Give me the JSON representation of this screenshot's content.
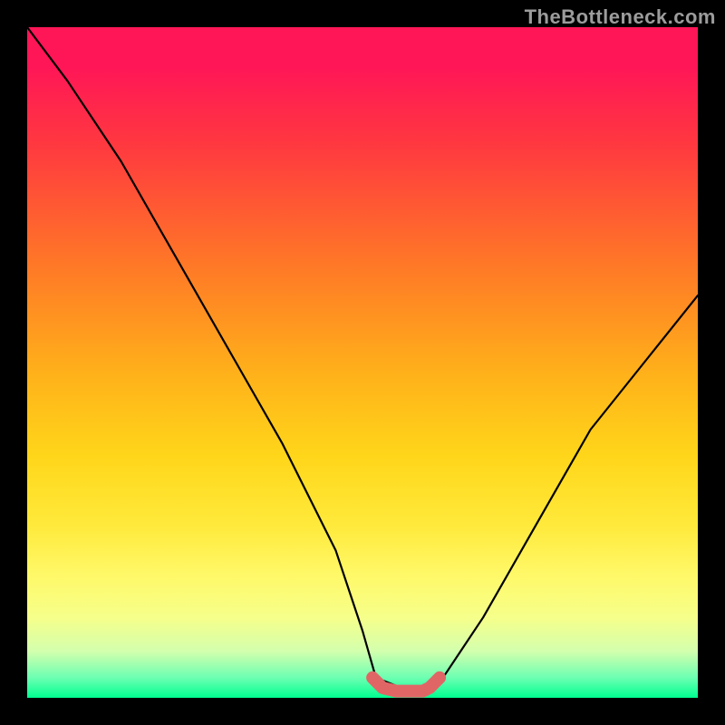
{
  "watermark": "TheBottleneck.com",
  "chart_data": {
    "type": "line",
    "title": "",
    "xlabel": "",
    "ylabel": "",
    "xlim": [
      0,
      100
    ],
    "ylim": [
      0,
      100
    ],
    "series": [
      {
        "name": "bottleneck-curve",
        "x": [
          0,
          6,
          14,
          22,
          30,
          38,
          46,
          50,
          52,
          57,
          60,
          62,
          68,
          76,
          84,
          92,
          100
        ],
        "values": [
          100,
          92,
          80,
          66,
          52,
          38,
          22,
          10,
          3,
          1,
          1,
          3,
          12,
          26,
          40,
          50,
          60
        ]
      }
    ],
    "highlight": {
      "name": "flat-minimum",
      "x": [
        51.5,
        53,
        55,
        57,
        59,
        60,
        61.5
      ],
      "values": [
        3,
        1.5,
        1,
        1,
        1,
        1.5,
        3
      ]
    },
    "background_gradient": [
      {
        "stop": 0.0,
        "color": "#ff1657"
      },
      {
        "stop": 0.06,
        "color": "#ff1657"
      },
      {
        "stop": 0.18,
        "color": "#ff3a3f"
      },
      {
        "stop": 0.36,
        "color": "#ff7a26"
      },
      {
        "stop": 0.52,
        "color": "#ffb21a"
      },
      {
        "stop": 0.64,
        "color": "#ffd61a"
      },
      {
        "stop": 0.74,
        "color": "#ffe93a"
      },
      {
        "stop": 0.82,
        "color": "#fff96a"
      },
      {
        "stop": 0.88,
        "color": "#f6ff8a"
      },
      {
        "stop": 0.93,
        "color": "#d4ffad"
      },
      {
        "stop": 0.97,
        "color": "#6dffb2"
      },
      {
        "stop": 1.0,
        "color": "#00ff90"
      }
    ]
  }
}
